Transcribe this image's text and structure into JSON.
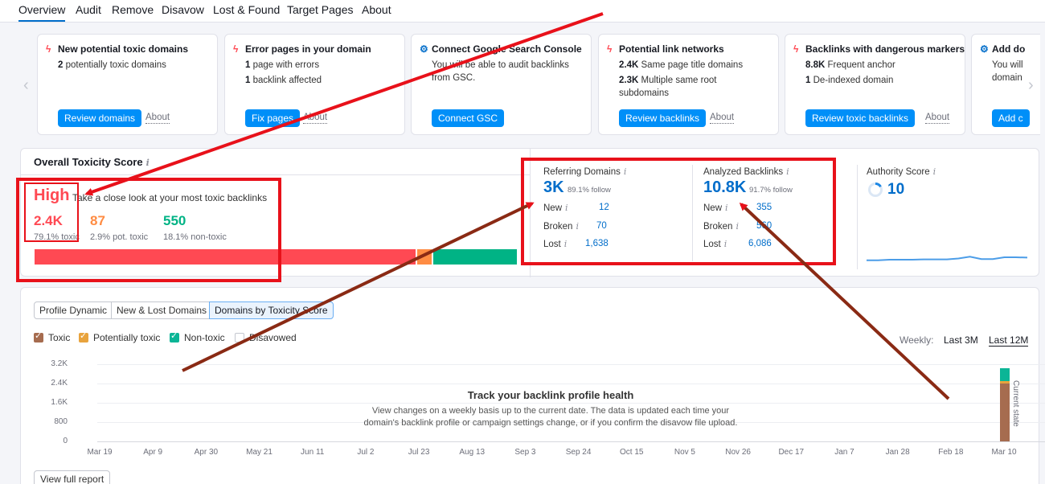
{
  "nav": {
    "tabs": [
      "Overview",
      "Audit",
      "Remove",
      "Disavow",
      "Lost & Found",
      "Target Pages",
      "About"
    ]
  },
  "cards": [
    {
      "title": "New potential toxic domains",
      "icon": "lightning-icon",
      "lines": [
        {
          "strong": "2",
          "text": "potentially toxic domains"
        }
      ],
      "button": "Review domains",
      "about": "About"
    },
    {
      "title": "Error pages in your domain",
      "icon": "lightning-icon",
      "lines": [
        {
          "strong": "1",
          "text": "page with errors"
        },
        {
          "strong": "1",
          "text": "backlink affected"
        }
      ],
      "button": "Fix pages",
      "about": "About"
    },
    {
      "title": "Connect Google Search Console",
      "icon": "gear-icon",
      "lines": [
        {
          "strong": "",
          "text": "You will be able to audit backlinks"
        },
        {
          "strong": "",
          "text": "from GSC."
        }
      ],
      "button": "Connect GSC",
      "about": ""
    },
    {
      "title": "Potential link networks",
      "icon": "lightning-icon",
      "lines": [
        {
          "strong": "2.4K",
          "text": "Same page title domains"
        },
        {
          "strong": "2.3K",
          "text": "Multiple same root"
        },
        {
          "strong": "",
          "text": "subdomains"
        }
      ],
      "button": "Review backlinks",
      "about": "About"
    },
    {
      "title": "Backlinks with dangerous markers",
      "icon": "lightning-icon",
      "lines": [
        {
          "strong": "8.8K",
          "text": "Frequent anchor"
        },
        {
          "strong": "1",
          "text": "De-indexed domain"
        }
      ],
      "button": "Review toxic backlinks",
      "about": "About"
    },
    {
      "title": "Add do",
      "icon": "gear-icon",
      "lines": [
        {
          "strong": "",
          "text": "You will"
        },
        {
          "strong": "",
          "text": "domain"
        }
      ],
      "button": "Add c",
      "about": ""
    }
  ],
  "toxicity": {
    "title": "Overall Toxicity Score",
    "level": "High",
    "description": "Take a close look at your most toxic backlinks",
    "toxic": {
      "value": "2.4K",
      "label": "79.1% toxic"
    },
    "pot_toxic": {
      "value": "87",
      "label": "2.9% pot. toxic"
    },
    "non_toxic": {
      "value": "550",
      "label": "18.1% non-toxic"
    },
    "bar_percent": {
      "toxic": 79.1,
      "pot_toxic": 2.9,
      "non_toxic": 18.1
    },
    "colors": {
      "toxic": "#ff4953",
      "pot_toxic": "#ff8c43",
      "non_toxic": "#00b385"
    }
  },
  "referring": {
    "title": "Referring Domains",
    "value": "3K",
    "follow": "89.1% follow",
    "rows": [
      {
        "label": "New",
        "value": "12"
      },
      {
        "label": "Broken",
        "value": "70"
      },
      {
        "label": "Lost",
        "value": "1,638"
      }
    ]
  },
  "backlinks": {
    "title": "Analyzed Backlinks",
    "value": "10.8K",
    "follow": "91.7% follow",
    "rows": [
      {
        "label": "New",
        "value": "355"
      },
      {
        "label": "Broken",
        "value": "560"
      },
      {
        "label": "Lost",
        "value": "6,086"
      }
    ]
  },
  "authority": {
    "title": "Authority Score",
    "value": "10"
  },
  "chart_panel": {
    "tabs": [
      "Profile Dynamic",
      "New & Lost Domains",
      "Domains by Toxicity Score"
    ],
    "legend": [
      {
        "label": "Toxic",
        "color": "#a66c4f",
        "checked": true
      },
      {
        "label": "Potentially toxic",
        "color": "#e8a33d",
        "checked": true
      },
      {
        "label": "Non-toxic",
        "color": "#0bb596",
        "checked": true
      },
      {
        "label": "Disavowed",
        "color": "#ffffff",
        "checked": false
      }
    ],
    "weekly_label": "Weekly:",
    "periods": [
      "Last 3M",
      "Last 12M"
    ],
    "selected_period": "Last 12M",
    "empty_title": "Track your backlink profile health",
    "empty_desc_1": "View changes on a weekly basis up to the current date. The data is updated each time your",
    "empty_desc_2": "domain's backlink profile or campaign settings change, or if you confirm the disavow file upload.",
    "current_state": "Current state",
    "view_full_report": "View full report"
  },
  "chart_data": {
    "type": "bar",
    "title": "Track your backlink profile health",
    "categories": [
      "Mar 19",
      "Apr 9",
      "Apr 30",
      "May 21",
      "Jun 11",
      "Jul 2",
      "Jul 23",
      "Aug 13",
      "Sep 3",
      "Sep 24",
      "Oct 15",
      "Nov 5",
      "Nov 26",
      "Dec 17",
      "Jan 7",
      "Jan 28",
      "Feb 18",
      "Mar 10"
    ],
    "y_ticks": [
      "3.2K",
      "2.4K",
      "1.6K",
      "800",
      "0"
    ],
    "ylim": [
      0,
      3200
    ],
    "series": [
      {
        "name": "Toxic",
        "values": [
          null,
          null,
          null,
          null,
          null,
          null,
          null,
          null,
          null,
          null,
          null,
          null,
          null,
          null,
          null,
          null,
          null,
          2400
        ]
      },
      {
        "name": "Potentially toxic",
        "values": [
          null,
          null,
          null,
          null,
          null,
          null,
          null,
          null,
          null,
          null,
          null,
          null,
          null,
          null,
          null,
          null,
          null,
          87
        ]
      },
      {
        "name": "Non-toxic",
        "values": [
          null,
          null,
          null,
          null,
          null,
          null,
          null,
          null,
          null,
          null,
          null,
          null,
          null,
          null,
          null,
          null,
          null,
          550
        ]
      }
    ],
    "grid": true,
    "legend": "top-left"
  },
  "authority_sparkline": [
    0.15,
    0.15,
    0.18,
    0.18,
    0.18,
    0.2,
    0.2,
    0.2,
    0.25,
    0.35,
    0.22,
    0.22,
    0.32,
    0.32,
    0.3
  ],
  "annotation_colors": {
    "box": "#e8111a",
    "arrow_red": "#e8111a",
    "arrow_brown": "#8a2a14"
  }
}
